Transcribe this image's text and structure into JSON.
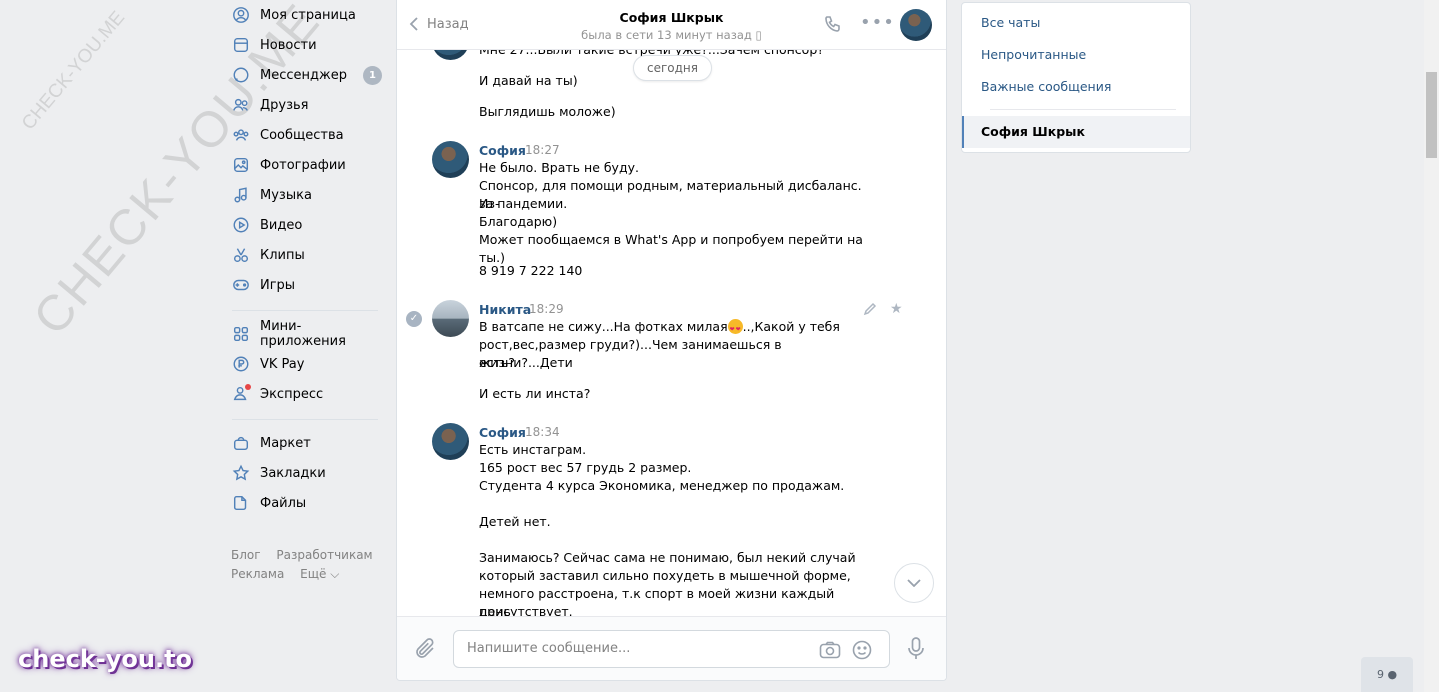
{
  "nav": {
    "items": [
      {
        "label": "Моя страница",
        "icon": "user-circle-icon"
      },
      {
        "label": "Новости",
        "icon": "news-icon"
      },
      {
        "label": "Мессенджер",
        "icon": "message-icon",
        "badge": "1"
      },
      {
        "label": "Друзья",
        "icon": "friends-icon"
      },
      {
        "label": "Сообщества",
        "icon": "groups-icon"
      },
      {
        "label": "Фотографии",
        "icon": "photo-icon"
      },
      {
        "label": "Музыка",
        "icon": "music-icon"
      },
      {
        "label": "Видео",
        "icon": "video-icon"
      },
      {
        "label": "Клипы",
        "icon": "clips-icon"
      },
      {
        "label": "Игры",
        "icon": "gamepad-icon"
      }
    ],
    "items2": [
      {
        "label": "Мини-приложения",
        "icon": "apps-icon"
      },
      {
        "label": "VK Pay",
        "icon": "vkpay-icon"
      },
      {
        "label": "Экспресс",
        "icon": "express-icon"
      }
    ],
    "items3": [
      {
        "label": "Маркет",
        "icon": "bag-icon"
      },
      {
        "label": "Закладки",
        "icon": "star-icon"
      },
      {
        "label": "Файлы",
        "icon": "file-icon"
      }
    ],
    "footer": {
      "blog": "Блог",
      "dev": "Разработчикам",
      "ads": "Реклама",
      "more": "Ещё ⌵"
    }
  },
  "watermark": {
    "big": "CHECK-YOU.ME",
    "small": "CHECK-YOU.ME",
    "brand": "check-you.to"
  },
  "chat": {
    "back": "Назад",
    "title": "София Шкрык",
    "status": "была в сети 13 минут назад",
    "date_pill": "сегодня",
    "msg0": {
      "lines": [
        "Мне 27...Были такие встречи уже?...Зачем спонсор?",
        "И давай на ты)",
        "Выглядишь моложе)"
      ]
    },
    "msg1": {
      "author": "София",
      "time": "18:27",
      "lines": [
        "Не было. Врать не буду.",
        "Спонсор, для помощи родным, материальный дисбаланс. Из-",
        "за пандемии.",
        "Благодарю)",
        "Может пообщаемся в What's App и попробуем перейти на ты.)",
        "8 919 7 222 140"
      ]
    },
    "msg2": {
      "author": "Никита",
      "time": "18:29",
      "line1a": "В ватсапе не сижу...На фотках милая",
      "line1b": "..,Какой у тебя",
      "lines": [
        "рост,вес,размер груди?)...Чем занимаешься в жизни?...Дети",
        "есть?",
        "И есть ли инста?"
      ]
    },
    "msg3": {
      "author": "София",
      "time": "18:34",
      "lines": [
        "Есть инстаграм.",
        "165 рост вес 57 грудь 2 размер.",
        "Студента 4 курса Экономика, менеджер по продажам.",
        "Детей нет.",
        "Занимаюсь? Сейчас сама не понимаю, был некий случай",
        "который заставил сильно похудеть в мышечной форме,",
        "немного расстроена, т.к спорт в моей жизни каждый день",
        "присутствует."
      ]
    },
    "composer_placeholder": "Напишите сообщение..."
  },
  "right": {
    "all": "Все чаты",
    "unread": "Непрочитанные",
    "important": "Важные сообщения",
    "active": "София Шкрык"
  },
  "online_count": "9"
}
